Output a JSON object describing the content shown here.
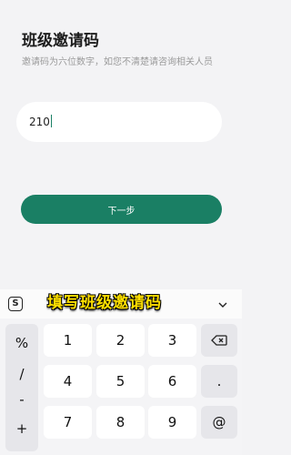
{
  "page": {
    "title": "班级邀请码",
    "description": "邀请码为六位数字，如您不清楚请咨询相关人员",
    "code_value": "210",
    "next_label": "下一步"
  },
  "ime": {
    "logo": "S",
    "caption": "填写班级邀请码",
    "collapse_icon": "chevron-down-icon"
  },
  "keyboard": {
    "symbols": [
      "%",
      "/",
      "-",
      "+"
    ],
    "row1": [
      "1",
      "2",
      "3"
    ],
    "row2": [
      "4",
      "5",
      "6"
    ],
    "row3": [
      "7",
      "8",
      "9"
    ],
    "backspace_icon": "backspace-icon",
    "dot": ".",
    "at": "@"
  }
}
